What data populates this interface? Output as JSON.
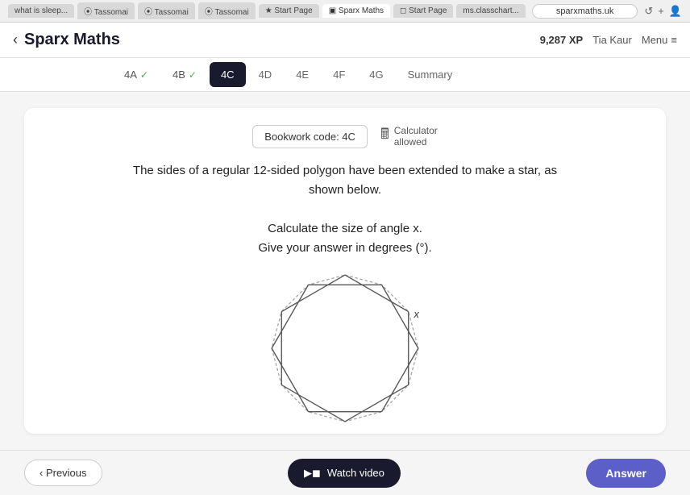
{
  "browser": {
    "tabs": [
      {
        "label": "what is sleep...",
        "active": false
      },
      {
        "label": "Tassomai",
        "active": false
      },
      {
        "label": "Tassomai",
        "active": false
      },
      {
        "label": "Tassomai",
        "active": false
      },
      {
        "label": "Start Page",
        "active": false
      },
      {
        "label": "Sparx Maths",
        "active": true
      },
      {
        "label": "Start Page",
        "active": false
      },
      {
        "label": "ms.classchart...",
        "active": false
      }
    ],
    "address": "sparxmaths.uk",
    "reload_icon": "↺",
    "plus_icon": "+",
    "person_icon": "👤"
  },
  "header": {
    "back_arrow": "‹",
    "title": "Sparx Maths",
    "xp": "9,287 XP",
    "user": "Tia Kaur",
    "menu_label": "Menu",
    "menu_icon": "≡"
  },
  "tabs": [
    {
      "id": "4A",
      "label": "4A",
      "completed": true,
      "active": false
    },
    {
      "id": "4B",
      "label": "4B",
      "completed": true,
      "active": false
    },
    {
      "id": "4C",
      "label": "4C",
      "completed": false,
      "active": true
    },
    {
      "id": "4D",
      "label": "4D",
      "completed": false,
      "active": false
    },
    {
      "id": "4E",
      "label": "4E",
      "completed": false,
      "active": false
    },
    {
      "id": "4F",
      "label": "4F",
      "completed": false,
      "active": false
    },
    {
      "id": "4G",
      "label": "4G",
      "completed": false,
      "active": false
    },
    {
      "id": "Summary",
      "label": "Summary",
      "completed": false,
      "active": false
    }
  ],
  "content": {
    "bookwork_code": "Bookwork code: 4C",
    "calculator_label": "Calculator",
    "calculator_sub": "allowed",
    "question_line1": "The sides of a regular 12-sided polygon have been extended to make a star, as",
    "question_line2": "shown below.",
    "question_line3": "Calculate the size of angle x.",
    "question_line4": "Give your answer in degrees (°)."
  },
  "footer": {
    "previous_label": "‹ Previous",
    "watch_video_label": "Watch video",
    "watch_video_icon": "▶",
    "answer_label": "Answer"
  }
}
